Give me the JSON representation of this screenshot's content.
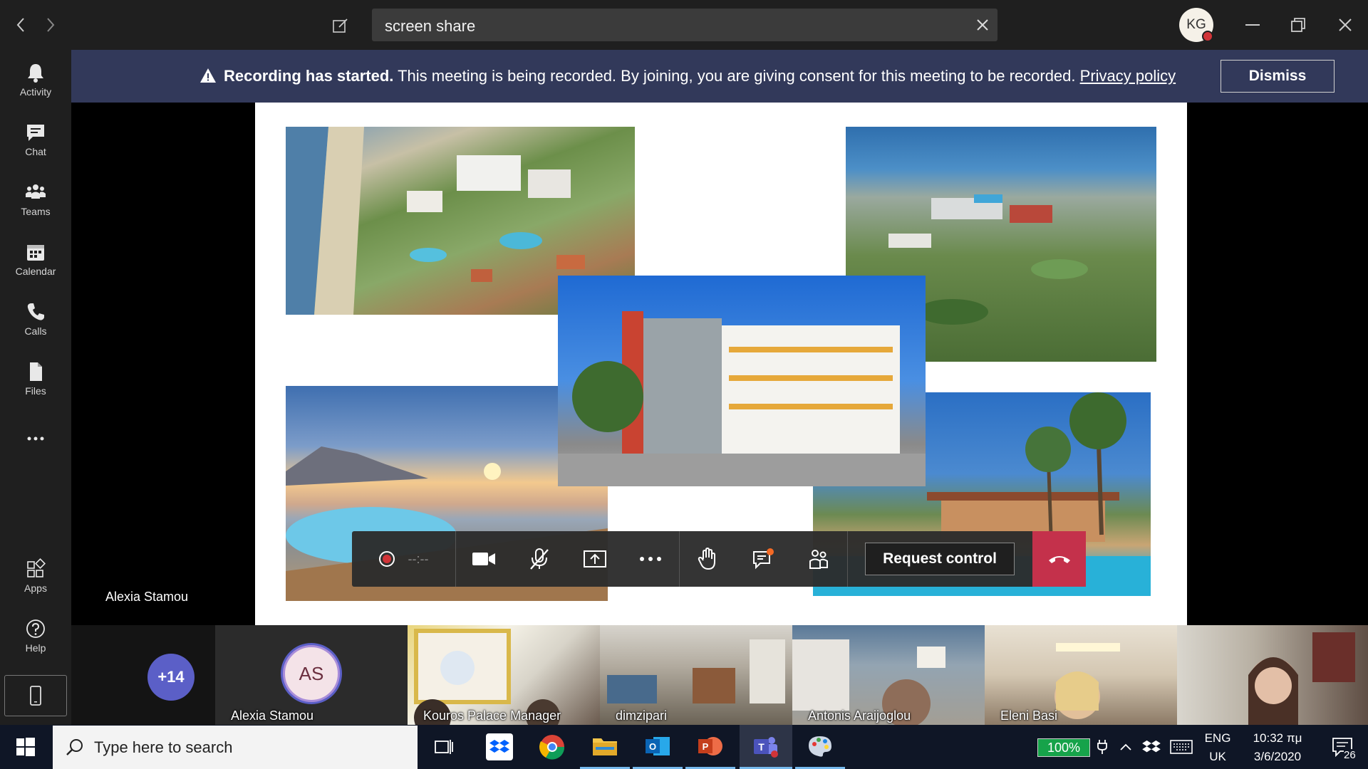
{
  "titlebar": {
    "search_value": "screen share",
    "user_initials": "KG"
  },
  "rail": {
    "items": [
      {
        "label": "Activity",
        "icon": "bell-icon"
      },
      {
        "label": "Chat",
        "icon": "chat-icon"
      },
      {
        "label": "Teams",
        "icon": "teams-icon"
      },
      {
        "label": "Calendar",
        "icon": "calendar-icon"
      },
      {
        "label": "Calls",
        "icon": "phone-icon"
      },
      {
        "label": "Files",
        "icon": "file-icon"
      }
    ],
    "apps_label": "Apps",
    "help_label": "Help"
  },
  "banner": {
    "bold": "Recording has started.",
    "text": " This meeting is being recorded. By joining, you are giving consent for this meeting to be recorded. ",
    "link": "Privacy policy",
    "dismiss": "Dismiss"
  },
  "stage": {
    "presenter": "Alexia Stamou"
  },
  "controls": {
    "timer": "--:--",
    "request_control": "Request control"
  },
  "participants": {
    "more_count": "+14",
    "tiles": [
      {
        "name": "Alexia Stamou",
        "initials": "AS"
      },
      {
        "name": "Kouros Palace Manager"
      },
      {
        "name": "dimzipari"
      },
      {
        "name": "Antonis Araijoglou"
      },
      {
        "name": "Eleni Basi"
      }
    ]
  },
  "taskbar": {
    "search_placeholder": "Type here to search",
    "battery": "100%",
    "lang_top": "ENG",
    "lang_bottom": "UK",
    "time": "10:32 πμ",
    "date": "3/6/2020",
    "notifications": "26"
  },
  "colors": {
    "banner": "#32395a",
    "accent": "#5b5fc7",
    "hangup": "#c4314b",
    "titlebar": "#1f1f1f"
  }
}
